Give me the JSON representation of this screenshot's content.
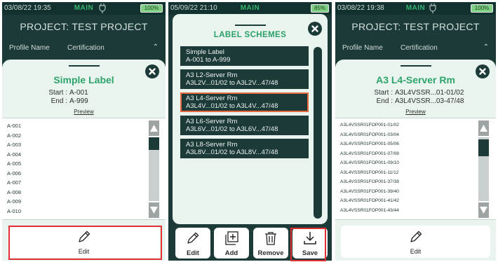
{
  "panel1": {
    "status": {
      "time": "03/08/22 19:35",
      "mode": "MAIN",
      "battery": "100%"
    },
    "project_title": "PROJECT: TEST PROJECT",
    "col_profile": "Profile Name",
    "col_cert": "Certification",
    "sheet": {
      "title": "Simple Label",
      "start_label": "Start :",
      "start_value": "A-001",
      "end_label": "End :",
      "end_value": "A-999",
      "preview": "Preview",
      "rows": [
        "A-001",
        "A-002",
        "A-003",
        "A-004",
        "A-005",
        "A-006",
        "A-007",
        "A-008",
        "A-009",
        "A-010"
      ],
      "edit": "Edit"
    }
  },
  "panel2": {
    "status": {
      "time": "05/09/22 21:10",
      "mode": "MAIN",
      "battery": "85%"
    },
    "title": "LABEL SCHEMES",
    "schemes": [
      {
        "name": "Simple Label",
        "range": "A-001 to A-999"
      },
      {
        "name": "A3 L2-Server Rm",
        "range": "A3L2V...01/02 to A3L2V...47/48"
      },
      {
        "name": "A3 L4-Server Rm",
        "range": "A3L4V...01/02 to A3L4V...47/48"
      },
      {
        "name": "A3 L6-Server Rm",
        "range": "A3L6V...01/02 to A3L6V...47/48"
      },
      {
        "name": "A3 L8-Server Rm",
        "range": "A3L8V...01/02 to A3L8V...47/48"
      }
    ],
    "selected_index": 2,
    "tools": {
      "edit": "Edit",
      "add": "Add",
      "remove": "Remove",
      "save": "Save"
    }
  },
  "panel3": {
    "status": {
      "time": "03/08/22 19:38",
      "mode": "MAIN",
      "battery": "100%"
    },
    "project_title": "PROJECT: TEST PROJECT",
    "col_profile": "Profile Name",
    "col_cert": "Certification",
    "sheet": {
      "title": "A3 L4-Server Rm",
      "start_label": "Start :",
      "start_value": "A3L4VSSR...01-01/02",
      "end_label": "End :",
      "end_value": "A3L4VSSR...03-47/48",
      "preview": "Preview",
      "rows": [
        "A3L4VSSR01FOP001-01/02",
        "A3L4VSSR01FOP001-03/04",
        "A3L4VSSR01FOP001-05/06",
        "A3L4VSSR01FOP001-07/08",
        "A3L4VSSR01FOP001-09/10",
        "A3L4VSSR01FOP001-11/12",
        "A3L4VSSR01FOP001-37/38",
        "A3L4VSSR01FOP001-39/40",
        "A3L4VSSR01FOP001-41/42",
        "A3L4VSSR01FOP001-43/44"
      ],
      "edit": "Edit"
    }
  },
  "colors": {
    "dark": "#1c3b38",
    "accent_green": "#2da46a",
    "sheet_bg": "#e9f4ee",
    "highlight_red": "#e12f33",
    "selected_orange": "#e5673d"
  }
}
